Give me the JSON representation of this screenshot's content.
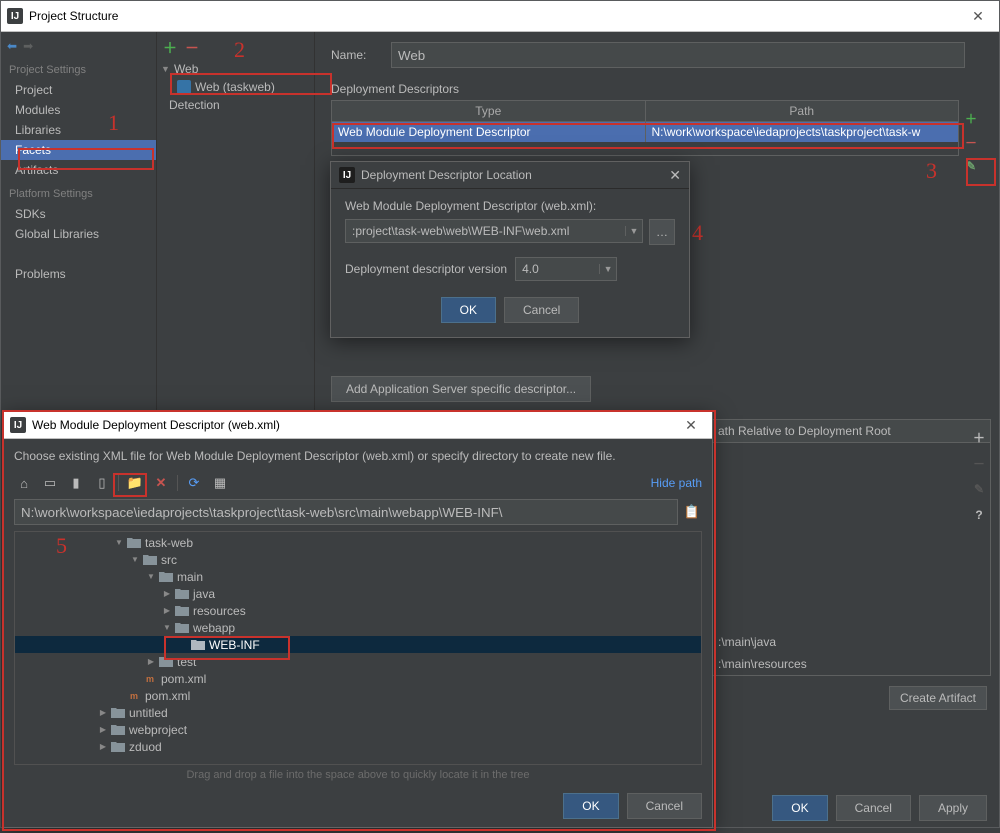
{
  "window": {
    "title": "Project Structure"
  },
  "sidebar": {
    "nav_back": "◄",
    "nav_fwd": "▶",
    "settings_hdr": "Project Settings",
    "items": [
      "Project",
      "Modules",
      "Libraries",
      "Facets",
      "Artifacts"
    ],
    "platform_hdr": "Platform Settings",
    "platform_items": [
      "SDKs",
      "Global Libraries"
    ],
    "problems": "Problems"
  },
  "facets_tree": {
    "root": "Web",
    "leaf": "Web (taskweb)",
    "detection": "Detection"
  },
  "form": {
    "name_lbl": "Name:",
    "name_val": "Web",
    "section": "Deployment Descriptors",
    "col_type": "Type",
    "col_path": "Path",
    "row_type": "Web Module Deployment Descriptor",
    "row_path": "N:\\work\\workspace\\iedaprojects\\taskproject\\task-w",
    "add_app": "Add Application Server specific descriptor..."
  },
  "ddl_dlg": {
    "title": "Deployment Descriptor Location",
    "label": "Web Module Deployment Descriptor (web.xml):",
    "path": ":project\\task-web\\web\\WEB-INF\\web.xml",
    "ver_lbl": "Deployment descriptor version",
    "ver_val": "4.0",
    "ok": "OK",
    "cancel": "Cancel"
  },
  "chooser": {
    "title": "Web Module Deployment Descriptor (web.xml)",
    "prompt": "Choose existing XML file for Web Module Deployment Descriptor (web.xml) or specify directory to create new file.",
    "hide": "Hide path",
    "path": "N:\\work\\workspace\\iedaprojects\\taskproject\\task-web\\src\\main\\webapp\\WEB-INF\\",
    "hint": "Drag and drop a file into the space above to quickly locate it in the tree",
    "ok": "OK",
    "cancel": "Cancel",
    "tree": {
      "taskweb": "task-web",
      "src": "src",
      "main": "main",
      "java": "java",
      "resources": "resources",
      "webapp": "webapp",
      "webinf": "WEB-INF",
      "test": "test",
      "pom1": "pom.xml",
      "pom2": "pom.xml",
      "untitled": "untitled",
      "webproject": "webproject",
      "zduod": "zduod"
    }
  },
  "src_frag": {
    "header": "ath Relative to Deployment Root",
    "java": ":\\main\\java",
    "resources": ":\\main\\resources",
    "create_btn": "Create Artifact"
  },
  "bottom": {
    "ok": "OK",
    "cancel": "Cancel",
    "apply": "Apply"
  },
  "annotations": [
    "1",
    "2",
    "3",
    "4",
    "5"
  ]
}
